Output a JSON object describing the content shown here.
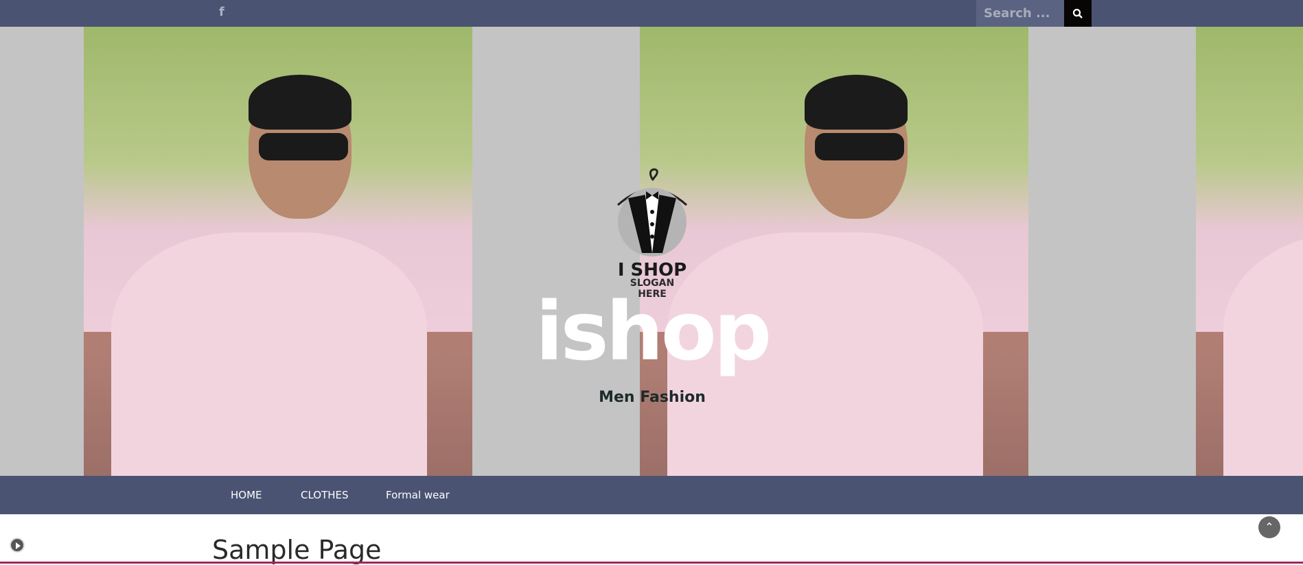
{
  "topbar": {
    "facebook_icon": "facebook-icon",
    "search_placeholder": "Search ...",
    "search_icon": "search-icon"
  },
  "hero": {
    "logo_line1": "I SHOP",
    "logo_line2": "SLOGAN HERE",
    "site_title": "ishop",
    "tagline": "Men Fashion"
  },
  "nav": {
    "items": [
      {
        "label": "HOME"
      },
      {
        "label": "CLOTHES"
      },
      {
        "label": "Formal wear"
      }
    ]
  },
  "page": {
    "title": "Sample Page"
  },
  "colors": {
    "bar": "#4a5372",
    "accent_line": "#a0275e"
  }
}
